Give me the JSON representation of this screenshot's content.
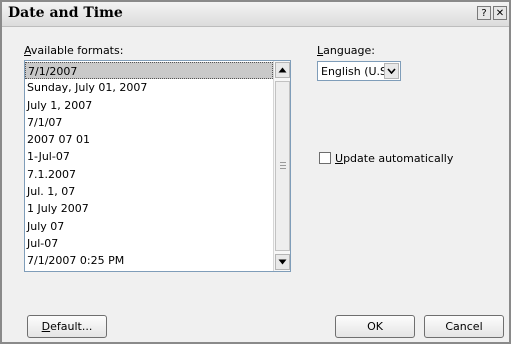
{
  "window": {
    "title": "Date and Time",
    "help_glyph": "?",
    "close_glyph": "✕"
  },
  "formats": {
    "label_first": "A",
    "label_rest": "vailable formats:",
    "items": [
      "7/1/2007",
      "Sunday, July 01, 2007",
      "July 1, 2007",
      "7/1/07",
      "2007 07 01",
      "1-Jul-07",
      "7.1.2007",
      "Jul. 1, 07",
      "1 July 2007",
      "July 07",
      "Jul-07",
      "7/1/2007 0:25 PM"
    ],
    "selected_index": 0
  },
  "language": {
    "label_first": "L",
    "label_rest": "anguage:",
    "value": "English (U.S.)"
  },
  "update": {
    "label_first": "U",
    "label_rest": "pdate automatically",
    "checked": false
  },
  "buttons": {
    "default_first": "D",
    "default_rest": "efault...",
    "ok": "OK",
    "cancel": "Cancel"
  },
  "icons": {
    "scroll_up": "triangle-up",
    "scroll_down": "triangle-down",
    "dropdown": "chevron-down",
    "help": "help",
    "close": "close"
  }
}
